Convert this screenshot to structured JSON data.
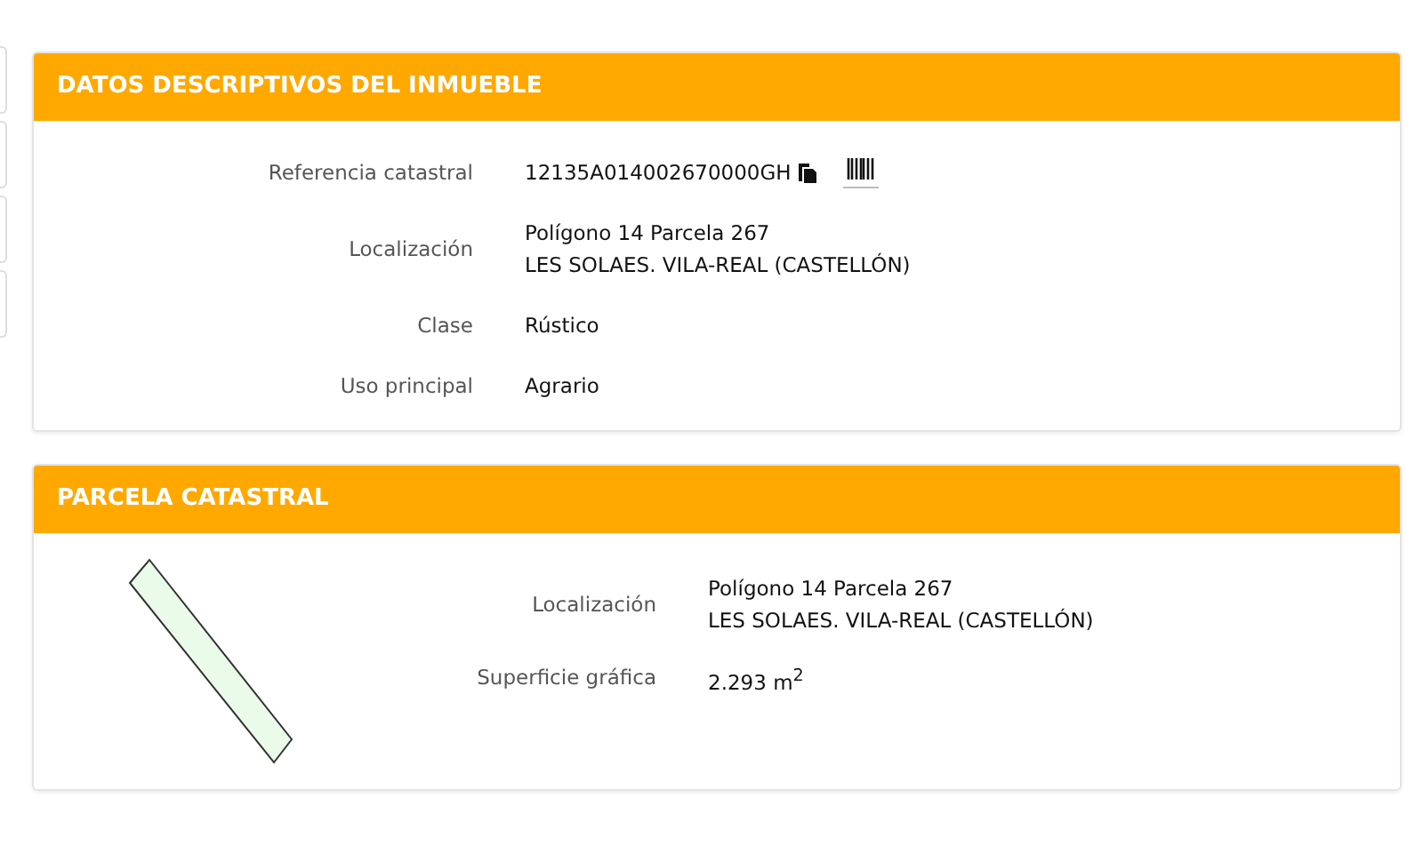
{
  "descriptive": {
    "title": "DATOS DESCRIPTIVOS DEL INMUEBLE",
    "rows": [
      {
        "label": "Referencia catastral",
        "kind": "reference",
        "lines": [
          "12135A014002670000GH"
        ]
      },
      {
        "label": "Localización",
        "kind": "text",
        "lines": [
          "Polígono 14 Parcela 267",
          "LES SOLAES. VILA-REAL (CASTELLÓN)"
        ]
      },
      {
        "label": "Clase",
        "kind": "text",
        "lines": [
          "Rústico"
        ]
      },
      {
        "label": "Uso principal",
        "kind": "text",
        "lines": [
          "Agrario"
        ]
      }
    ]
  },
  "parcel": {
    "title": "PARCELA CATASTRAL",
    "rows": [
      {
        "label": "Localización",
        "kind": "text",
        "lines": [
          "Polígono 14 Parcela 267",
          "LES SOLAES. VILA-REAL (CASTELLÓN)"
        ]
      },
      {
        "label": "Superficie gráfica",
        "kind": "rich",
        "lines": [
          "2.293 m$^{2}$"
        ]
      }
    ]
  }
}
